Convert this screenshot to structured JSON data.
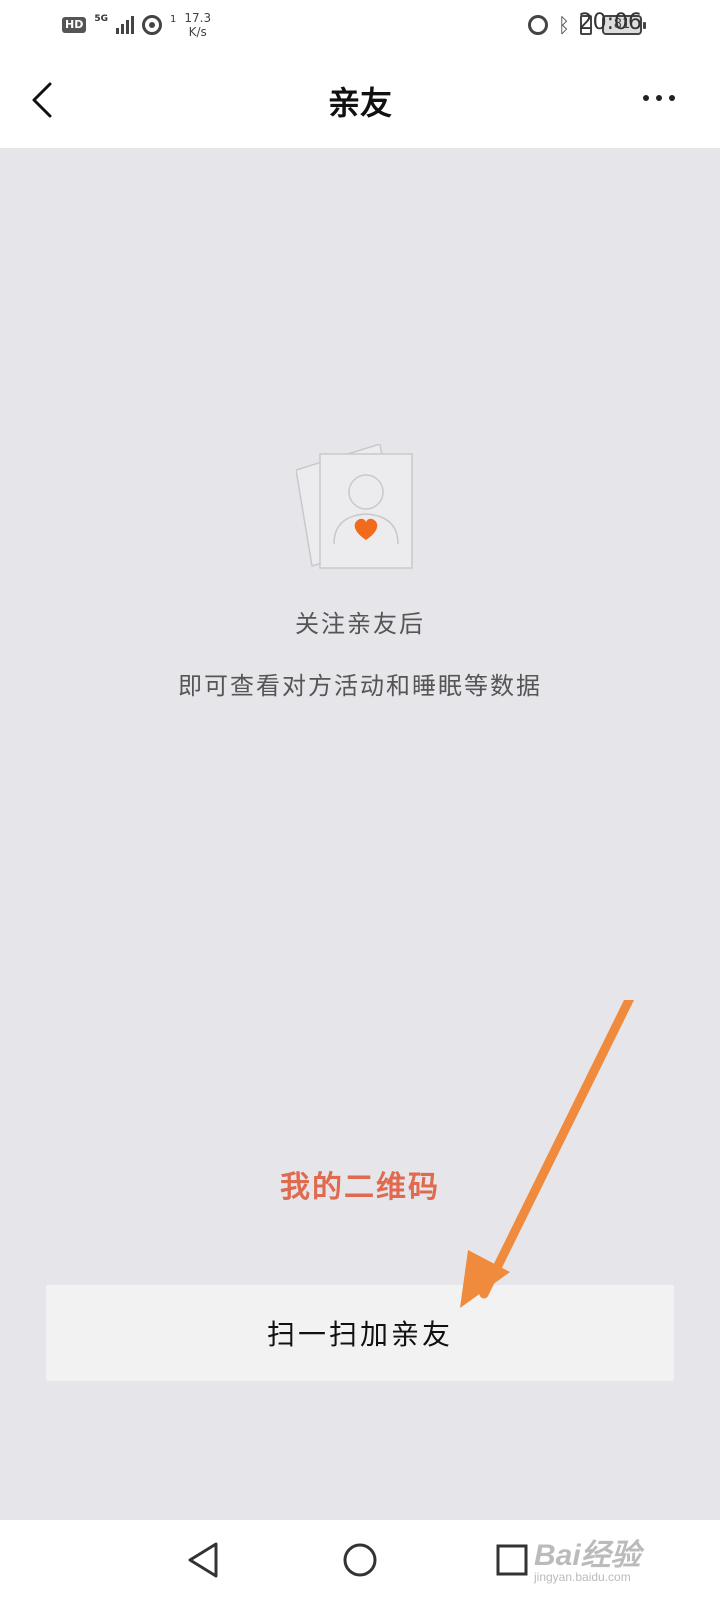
{
  "status_bar": {
    "hd": "HD",
    "network": "5G",
    "sim_index": "1",
    "speed_value": "17.3",
    "speed_unit": "K/s",
    "battery": "81",
    "time": "20:06"
  },
  "nav": {
    "title": "亲友"
  },
  "empty_state": {
    "line1": "关注亲友后",
    "line2": "即可查看对方活动和睡眠等数据",
    "heart_color": "#f26a1b"
  },
  "qr_link": "我的二维码",
  "scan_button": "扫一扫加亲友",
  "annotation": {
    "arrow_color": "#f08a3c"
  },
  "watermark": {
    "main": "Bai经验",
    "sub": "jingyan.baidu.com"
  }
}
